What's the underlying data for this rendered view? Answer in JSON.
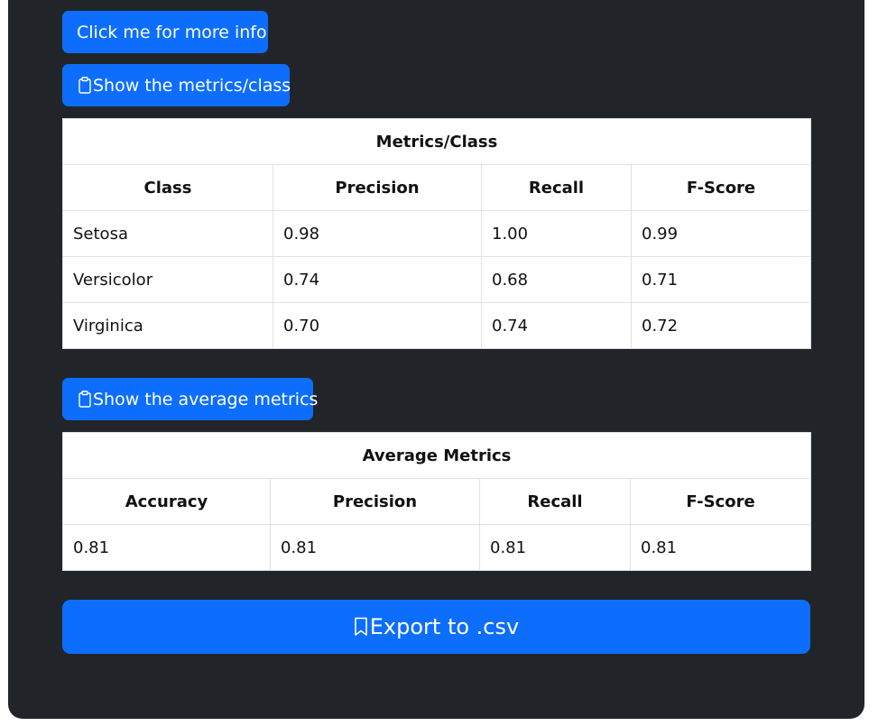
{
  "buttons": {
    "info_label": "Click me for more info",
    "metrics_label": "Show the metrics/class",
    "avg_label": "Show the average metrics",
    "export_label": "Export to .csv"
  },
  "icons": {
    "metrics_icon": "clipboard-icon",
    "avg_icon": "clipboard-icon",
    "export_icon": "bookmark-icon"
  },
  "colors": {
    "panel_bg": "#212529",
    "button_bg": "#0d6efd",
    "table_bg": "#ffffff"
  },
  "class_table": {
    "title": "Metrics/Class",
    "headers": [
      "Class",
      "Precision",
      "Recall",
      "F-Score"
    ],
    "rows": [
      [
        "Setosa",
        "0.98",
        "1.00",
        "0.99"
      ],
      [
        "Versicolor",
        "0.74",
        "0.68",
        "0.71"
      ],
      [
        "Virginica",
        "0.70",
        "0.74",
        "0.72"
      ]
    ]
  },
  "avg_table": {
    "title": "Average Metrics",
    "headers": [
      "Accuracy",
      "Precision",
      "Recall",
      "F-Score"
    ],
    "rows": [
      [
        "0.81",
        "0.81",
        "0.81",
        "0.81"
      ]
    ]
  }
}
